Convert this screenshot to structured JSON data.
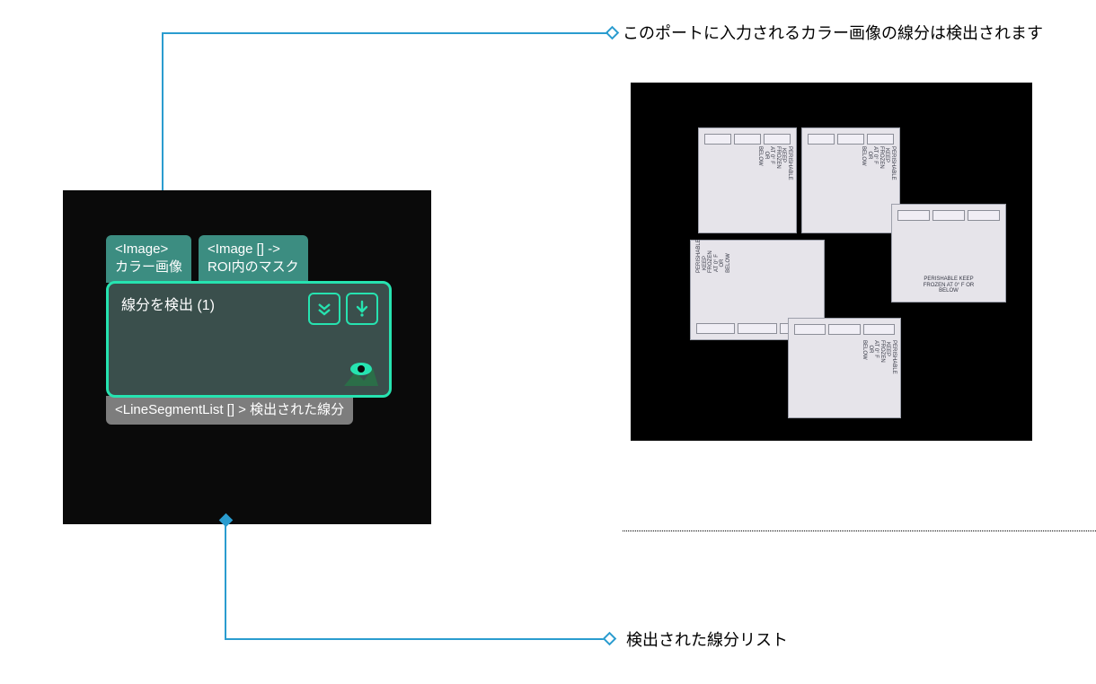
{
  "annotations": {
    "top": "このポートに入力されるカラー画像の線分は検出されます",
    "bottom": "検出された線分リスト"
  },
  "node": {
    "input_ports": [
      {
        "type": "<Image>",
        "label": "カラー画像"
      },
      {
        "type": "<Image [] ->",
        "label": "ROI内のマスク"
      }
    ],
    "title": "線分を検出 (1)",
    "output_port": {
      "type": "<LineSegmentList [] >",
      "label": "検出された線分"
    }
  },
  "sample_image": {
    "description": "カラー画像サンプル（段ボール箱）",
    "box_sticker": "PERISHABLE KEEP FROZEN AT 0° F OR BELOW"
  }
}
